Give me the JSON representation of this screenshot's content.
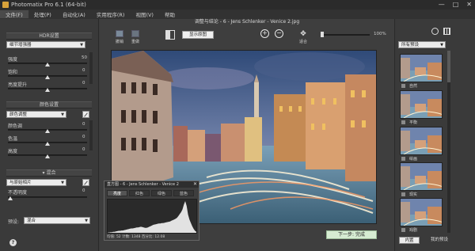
{
  "window": {
    "title": "Photomatix Pro 6.1 (64-bit)"
  },
  "menu": [
    "文件(F)",
    "处理(P)",
    "自动化(A)",
    "实用程序(R)",
    "视图(V)",
    "帮助"
  ],
  "left": {
    "section1": "HDR设置",
    "method": "细节增强器",
    "sliders1": [
      {
        "label": "强度",
        "value": "50"
      },
      {
        "label": "饱和",
        "value": "0"
      },
      {
        "label": "亮度提升",
        "value": "0"
      }
    ],
    "section2": "颜色设置",
    "color_mode": "颜色调整",
    "sliders2": [
      {
        "label": "颜色调",
        "value": "0"
      },
      {
        "label": "色温",
        "value": "0"
      },
      {
        "label": "高度",
        "value": "0"
      }
    ],
    "section3": "混合",
    "blend_mode": "与原始相片",
    "opacity_label": "不透明度",
    "opacity_value": "0",
    "preset_label": "预设:",
    "preset_value": "混合"
  },
  "viewer": {
    "title": "调整与结论 - 6 - Jens Schlenker - Venice 2.jpg",
    "undo_label": "撤销",
    "redo_label": "重做",
    "show_original_label": "显示原图",
    "fit_label": "适合",
    "zoom_percent": "100%",
    "next_button": "下一步: 完成"
  },
  "histogram": {
    "title": "直方图 - 6 - Jens Schlenker - Venice 2",
    "tabs": [
      "亮度",
      "红色",
      "绿色",
      "蓝色"
    ],
    "footer": "均值: 52    计数: 1348    百分比: 12.08",
    "levels": [
      1,
      1,
      2,
      2,
      3,
      3,
      4,
      5,
      6,
      6,
      7,
      7,
      8,
      9,
      10,
      11,
      12,
      13,
      13,
      14,
      15,
      16,
      16,
      17,
      18,
      17,
      16,
      15,
      15,
      16,
      18,
      20,
      22,
      24,
      25,
      26,
      27,
      28,
      28,
      29,
      29,
      30,
      31,
      32,
      33,
      34,
      36,
      38,
      40,
      42,
      45,
      50,
      56,
      62,
      70,
      85,
      95,
      80,
      55,
      40,
      30,
      20,
      12,
      6,
      3
    ]
  },
  "right": {
    "header": "所有预设",
    "presets": [
      "自然",
      "平衡",
      "绘画",
      "现实",
      "戏剧"
    ],
    "tab_builtin": "内置",
    "tab_mine": "我的预设"
  }
}
